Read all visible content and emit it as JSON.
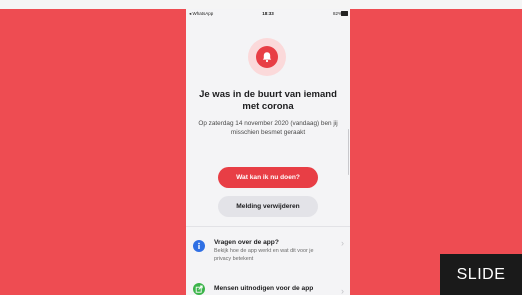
{
  "status_bar": {
    "carrier": "◂ WhatsApp",
    "time": "18:33",
    "battery": "82%"
  },
  "alert": {
    "icon": "bell-icon",
    "title": "Je was in de buurt van iemand met corona",
    "subtitle": "Op zaterdag 14 november 2020 (vandaag) ben jij misschien besmet geraakt"
  },
  "actions": {
    "primary_label": "Wat kan ik nu doen?",
    "secondary_label": "Melding verwijderen"
  },
  "list": {
    "items": [
      {
        "icon": "info-icon",
        "title": "Vragen over de app?",
        "description": "Bekijk hoe de app werkt en wat dit voor je privacy betekent"
      },
      {
        "icon": "share-icon",
        "title": "Mensen uitnodigen voor de app",
        "description": ""
      }
    ]
  },
  "watermark": "SLIDE",
  "colors": {
    "background": "#ee4c52",
    "accent": "#e83e45",
    "info": "#2f6fe4",
    "share": "#3cb44a"
  }
}
